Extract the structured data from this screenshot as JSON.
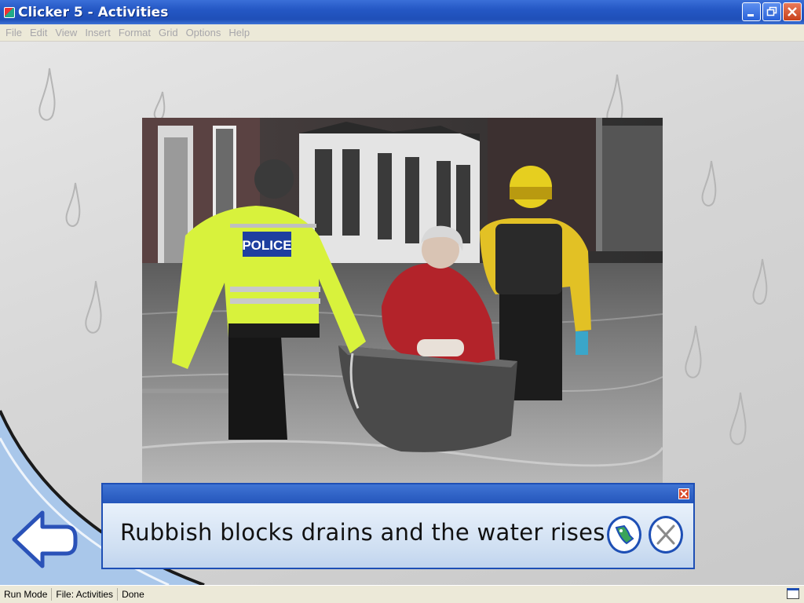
{
  "window": {
    "title": "Clicker 5 - Activities"
  },
  "menu": [
    "File",
    "Edit",
    "View",
    "Insert",
    "Format",
    "Grid",
    "Options",
    "Help"
  ],
  "photo": {
    "badge_text": "POLICE"
  },
  "sentence_panel": {
    "text": "Rubbish blocks drains and the water rises."
  },
  "statusbar": {
    "mode": "Run Mode",
    "file": "File: Activities",
    "state": "Done"
  },
  "icons": {
    "app": "clicker-app-icon",
    "minimize": "minimize-icon",
    "restore": "restore-icon",
    "close": "close-icon",
    "back": "back-arrow-icon",
    "speak": "speak-icon",
    "cancel": "cancel-icon"
  },
  "colors": {
    "titlebar": "#2457c4",
    "panel_border": "#1e4fb5",
    "close_red": "#c8421c",
    "hi_vis_yellow": "#d8f23c"
  }
}
